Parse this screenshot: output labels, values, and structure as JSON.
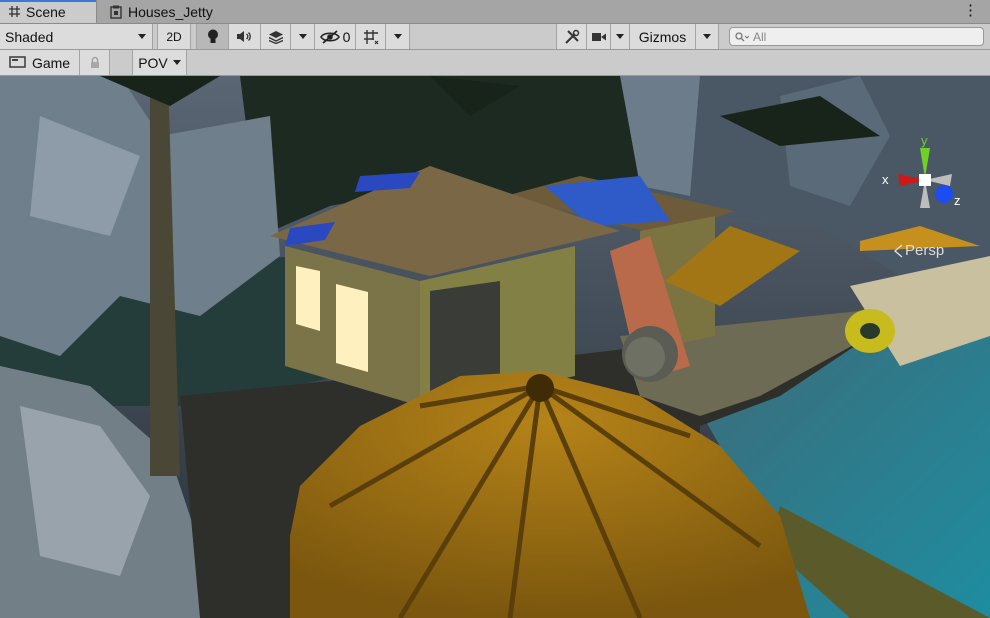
{
  "tabs": [
    {
      "label": "Scene",
      "icon": "grid-icon",
      "active": true
    },
    {
      "label": "Houses_Jetty",
      "icon": "scene-file-icon",
      "active": false
    }
  ],
  "toolbar": {
    "draw_mode": "Shaded",
    "mode_2d": "2D",
    "hidden_count": "0",
    "gizmos_label": "Gizmos",
    "search_placeholder": "All"
  },
  "toolbar2": {
    "game_label": "Game",
    "pov_label": "POV"
  },
  "viewport": {
    "gizmo_y": "y",
    "gizmo_x": "x",
    "gizmo_z": "z",
    "projection": "Persp"
  },
  "colors": {
    "tab_accent": "#3a79d8",
    "gizmo_x": "#d01818",
    "gizmo_y": "#6fd128",
    "gizmo_z": "#1c4cf2"
  }
}
